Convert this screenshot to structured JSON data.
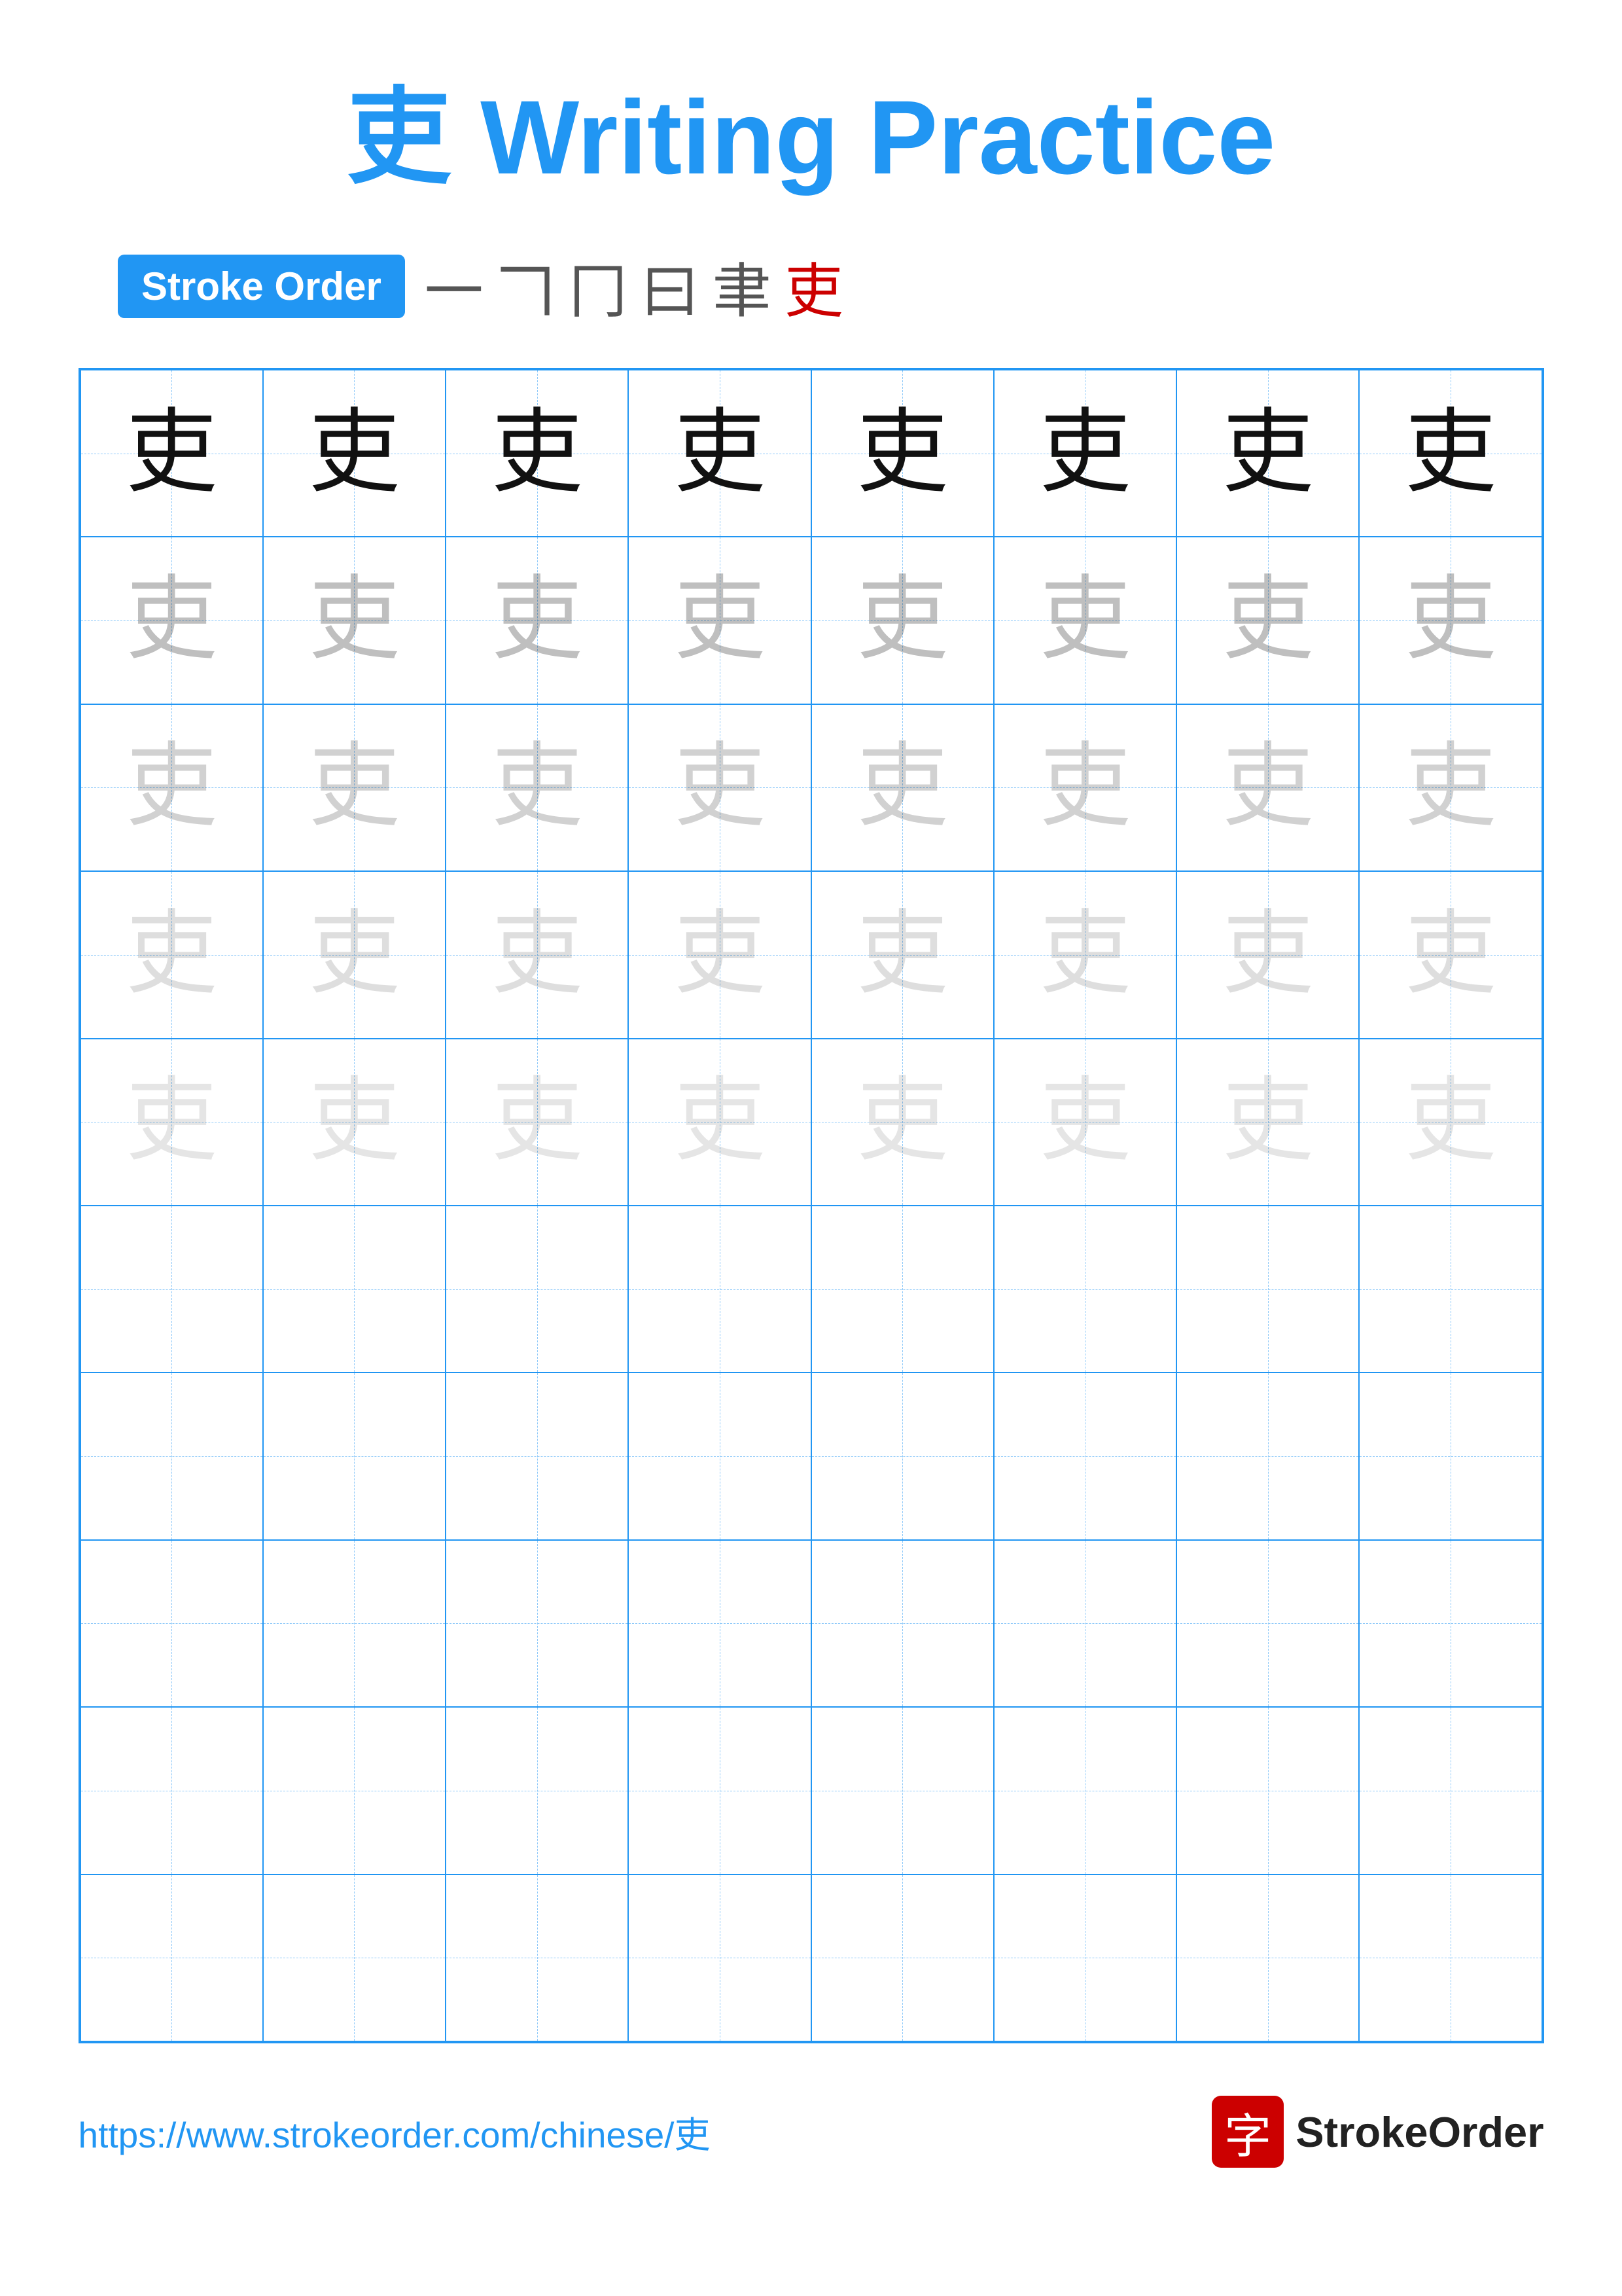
{
  "title": "吏 Writing Practice",
  "stroke_order_badge": "Stroke Order",
  "stroke_order_chars": [
    "一",
    "𠃍",
    "冂",
    "曰",
    "聿",
    "吏"
  ],
  "character": "吏",
  "grid": {
    "rows": 10,
    "cols": 8
  },
  "char_rows": [
    {
      "opacity": "dark"
    },
    {
      "opacity": "light1"
    },
    {
      "opacity": "light2"
    },
    {
      "opacity": "light3"
    },
    {
      "opacity": "light4"
    },
    {
      "opacity": "empty"
    },
    {
      "opacity": "empty"
    },
    {
      "opacity": "empty"
    },
    {
      "opacity": "empty"
    },
    {
      "opacity": "empty"
    }
  ],
  "footer": {
    "url": "https://www.strokeorder.com/chinese/吏",
    "logo_char": "字",
    "logo_text": "StrokeOrder"
  }
}
